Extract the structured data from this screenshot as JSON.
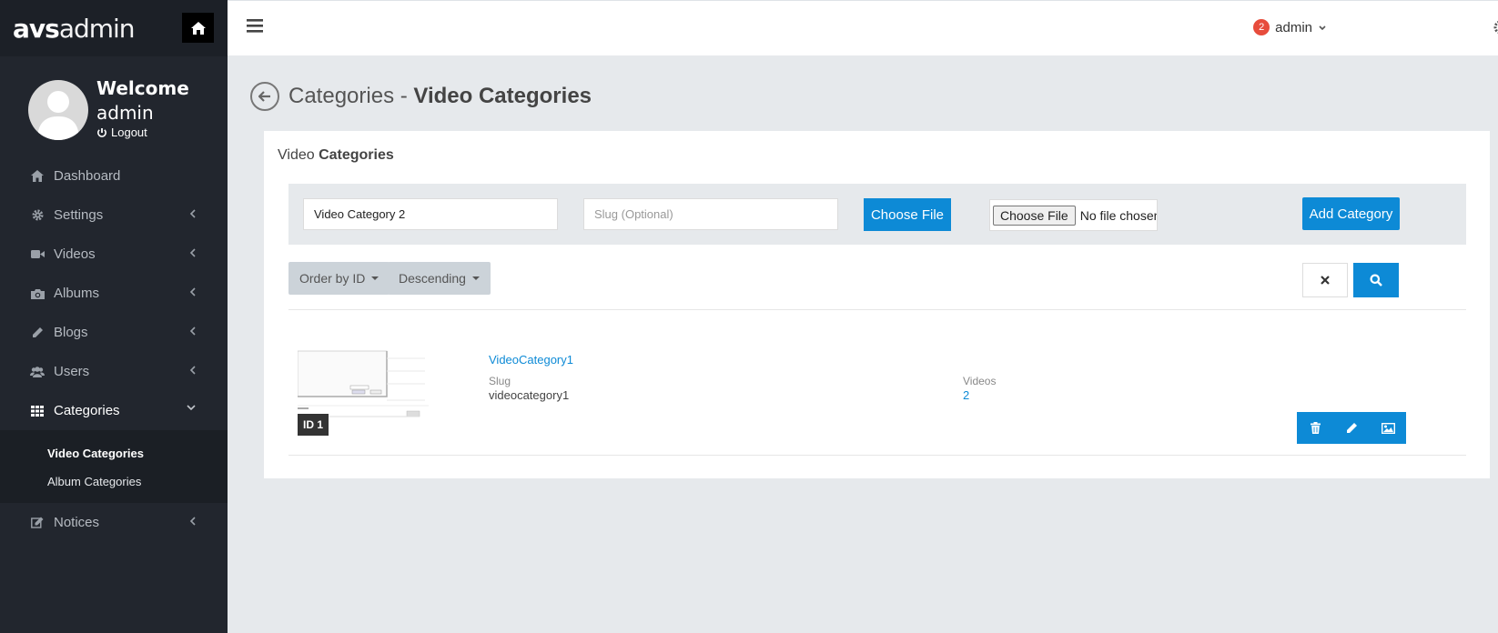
{
  "brand": {
    "bold": "avs",
    "light": "admin"
  },
  "profile": {
    "welcome_line1": "Welcome",
    "welcome_line2": "admin",
    "logout": "Logout"
  },
  "nav": {
    "dashboard": "Dashboard",
    "settings": "Settings",
    "videos": "Videos",
    "albums": "Albums",
    "blogs": "Blogs",
    "users": "Users",
    "categories": "Categories",
    "video_categories": "Video Categories",
    "album_categories": "Album Categories",
    "notices": "Notices"
  },
  "topbar": {
    "notification_count": "2",
    "user": "admin"
  },
  "page": {
    "title_light": "Categories - ",
    "title_bold": "Video Categories"
  },
  "panel": {
    "title_light": "Video ",
    "title_bold": "Categories",
    "name_input_value": "Video Category 2",
    "slug_placeholder": "Slug (Optional)",
    "choose_file_label": "Choose File",
    "native_file_button": "Choose File",
    "native_file_status": "No file chosen",
    "add_button": "Add Category",
    "order_by": "Order by ID",
    "direction": "Descending"
  },
  "categories": [
    {
      "id_badge": "ID 1",
      "name": "VideoCategory1",
      "slug_label": "Slug",
      "slug": "videocategory1",
      "videos_label": "Videos",
      "videos": "2"
    }
  ],
  "colors": {
    "accent": "#0d8ad6",
    "sidebar": "#22262e",
    "badge": "#e74c3c"
  }
}
